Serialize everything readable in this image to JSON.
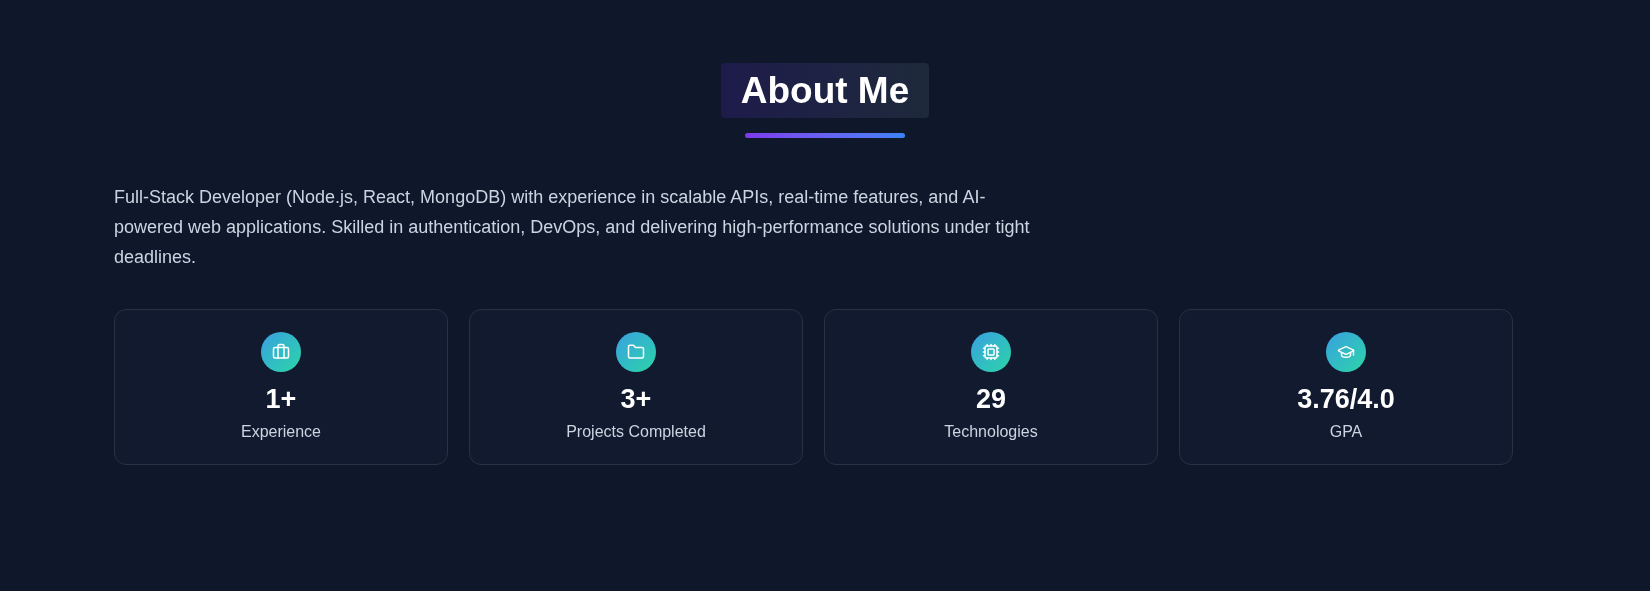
{
  "section": {
    "title": "About Me"
  },
  "intro": "Full-Stack Developer (Node.js, React, MongoDB) with experience in scalable APIs, real-time features, and AI-powered web applications. Skilled in authentication, DevOps, and delivering high-performance solutions under tight deadlines.",
  "stats": [
    {
      "kind": "briefcase",
      "value": "1+",
      "label": "Experience"
    },
    {
      "kind": "folder",
      "value": "3+",
      "label": "Projects Completed"
    },
    {
      "kind": "chip",
      "value": "29",
      "label": "Technologies"
    },
    {
      "kind": "graduation-cap",
      "value": "3.76/4.0",
      "label": "GPA"
    }
  ]
}
